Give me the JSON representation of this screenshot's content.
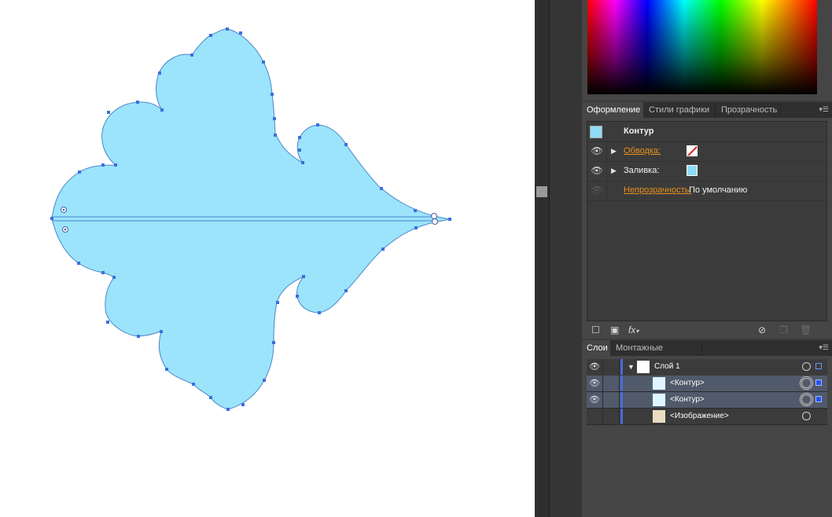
{
  "colors": {
    "shape_fill": "#9be4fb",
    "shape_stroke": "#4a86c8",
    "anchor_point": "#3b6fdf",
    "link_orange": "#e8901e",
    "selection_blue": "#2255ee"
  },
  "appearance_panel": {
    "tabs": [
      "Оформление",
      "Стили графики",
      "Прозрачность"
    ],
    "menu_icon": "panel-menu-icon",
    "object_label": "Контур",
    "rows": [
      {
        "label": "Обводка:",
        "swatch": "none-red-slash"
      },
      {
        "label": "Заливка:",
        "swatch": "light-blue"
      },
      {
        "label": "Непрозрачность:",
        "value": "По умолчанию"
      }
    ],
    "fx_label": "fx",
    "footer_icons": [
      "new-stroke-icon",
      "new-fill-icon",
      "fx-icon",
      "clear-icon",
      "duplicate-icon",
      "trash-icon"
    ]
  },
  "layers_panel": {
    "tabs": [
      "Слои",
      "Монтажные области"
    ],
    "menu_icon": "panel-menu-icon",
    "rows": [
      {
        "name": "Слой 1",
        "expanded": true,
        "selected": false
      },
      {
        "name": "<Контур>",
        "selected": true
      },
      {
        "name": "<Контур>",
        "selected": true
      },
      {
        "name": "<Изображение>",
        "selected": false
      }
    ]
  }
}
